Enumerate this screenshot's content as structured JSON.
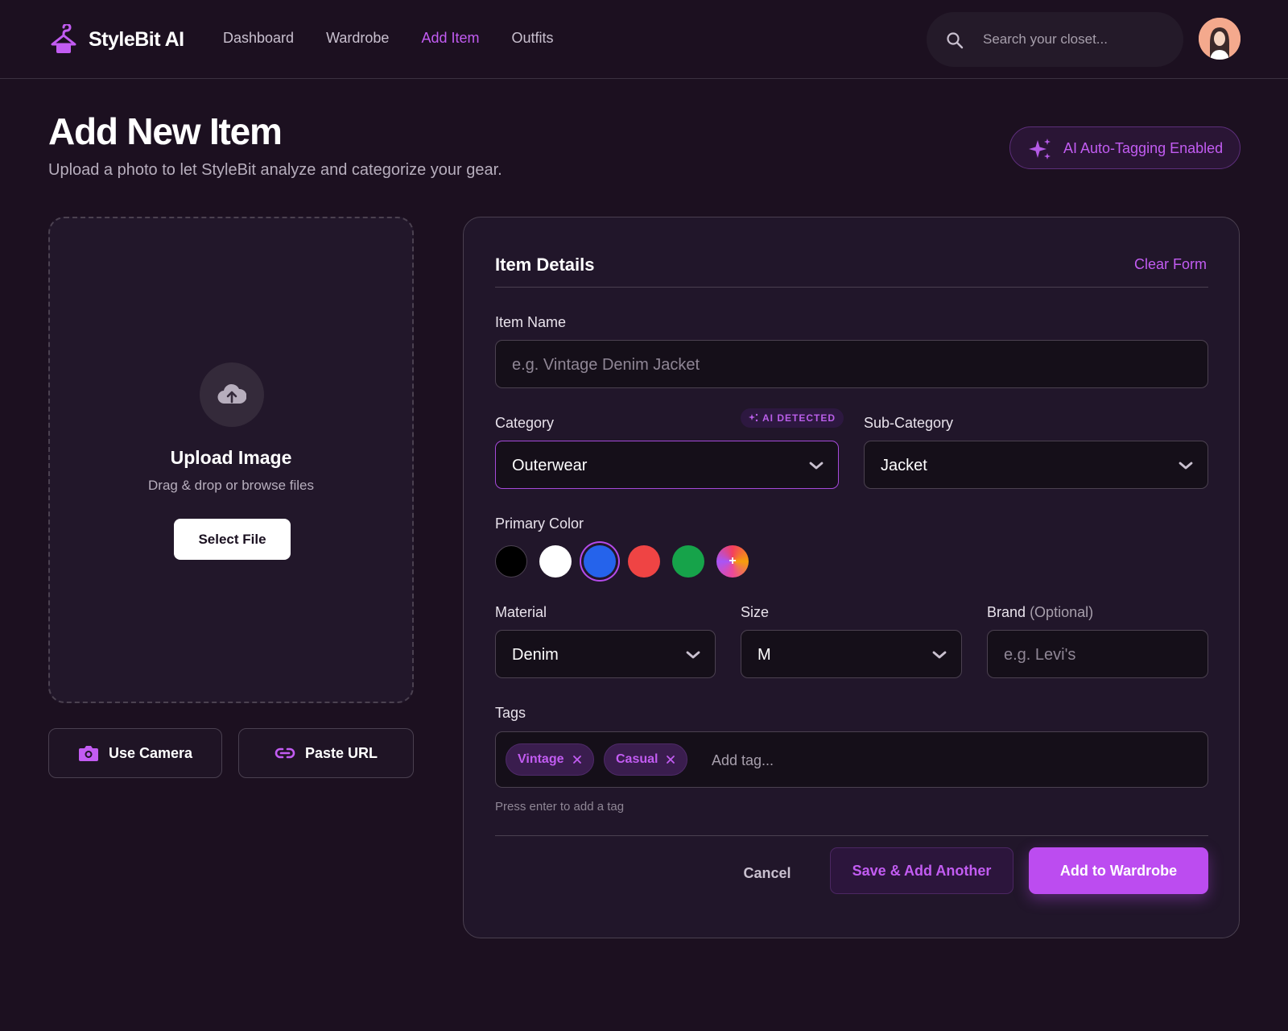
{
  "brand": {
    "name": "StyleBit AI",
    "icon": "hanger-icon",
    "accent": "#c25cf2"
  },
  "nav": {
    "items": [
      {
        "label": "Dashboard",
        "active": false
      },
      {
        "label": "Wardrobe",
        "active": false
      },
      {
        "label": "Add Item",
        "active": true
      },
      {
        "label": "Outfits",
        "active": false
      }
    ]
  },
  "search": {
    "placeholder": "Search your closet...",
    "value": ""
  },
  "page": {
    "title": "Add New Item",
    "subtitle": "Upload a photo to let StyleBit analyze and categorize your gear.",
    "ai_badge": "AI Auto-Tagging Enabled"
  },
  "upload": {
    "title": "Upload Image",
    "subtitle": "Drag & drop or browse files",
    "select_label": "Select File",
    "camera_label": "Use Camera",
    "url_label": "Paste URL"
  },
  "form": {
    "title": "Item Details",
    "clear_label": "Clear Form",
    "item_name": {
      "label": "Item Name",
      "placeholder": "e.g. Vintage Denim Jacket",
      "value": ""
    },
    "category": {
      "label": "Category",
      "value": "Outerwear",
      "ai_badge": "AI DETECTED"
    },
    "sub_category": {
      "label": "Sub-Category",
      "value": "Jacket"
    },
    "primary_color": {
      "label": "Primary Color",
      "swatches": [
        {
          "name": "black",
          "hex": "#000000",
          "selected": false
        },
        {
          "name": "white",
          "hex": "#ffffff",
          "selected": false
        },
        {
          "name": "blue",
          "hex": "#2563eb",
          "selected": true
        },
        {
          "name": "red",
          "hex": "#ef4444",
          "selected": false
        },
        {
          "name": "green",
          "hex": "#16a34a",
          "selected": false
        },
        {
          "name": "custom",
          "hex": "gradient",
          "selected": false
        }
      ],
      "custom_symbol": "+"
    },
    "material": {
      "label": "Material",
      "value": "Denim"
    },
    "size": {
      "label": "Size",
      "value": "M"
    },
    "brand_field": {
      "label": "Brand",
      "optional": "(Optional)",
      "placeholder": "e.g. Levi's",
      "value": ""
    },
    "tags": {
      "label": "Tags",
      "items": [
        "Vintage",
        "Casual"
      ],
      "placeholder": "Add tag...",
      "hint": "Press enter to add a tag"
    },
    "actions": {
      "cancel": "Cancel",
      "save_another": "Save & Add Another",
      "add": "Add to Wardrobe"
    }
  }
}
